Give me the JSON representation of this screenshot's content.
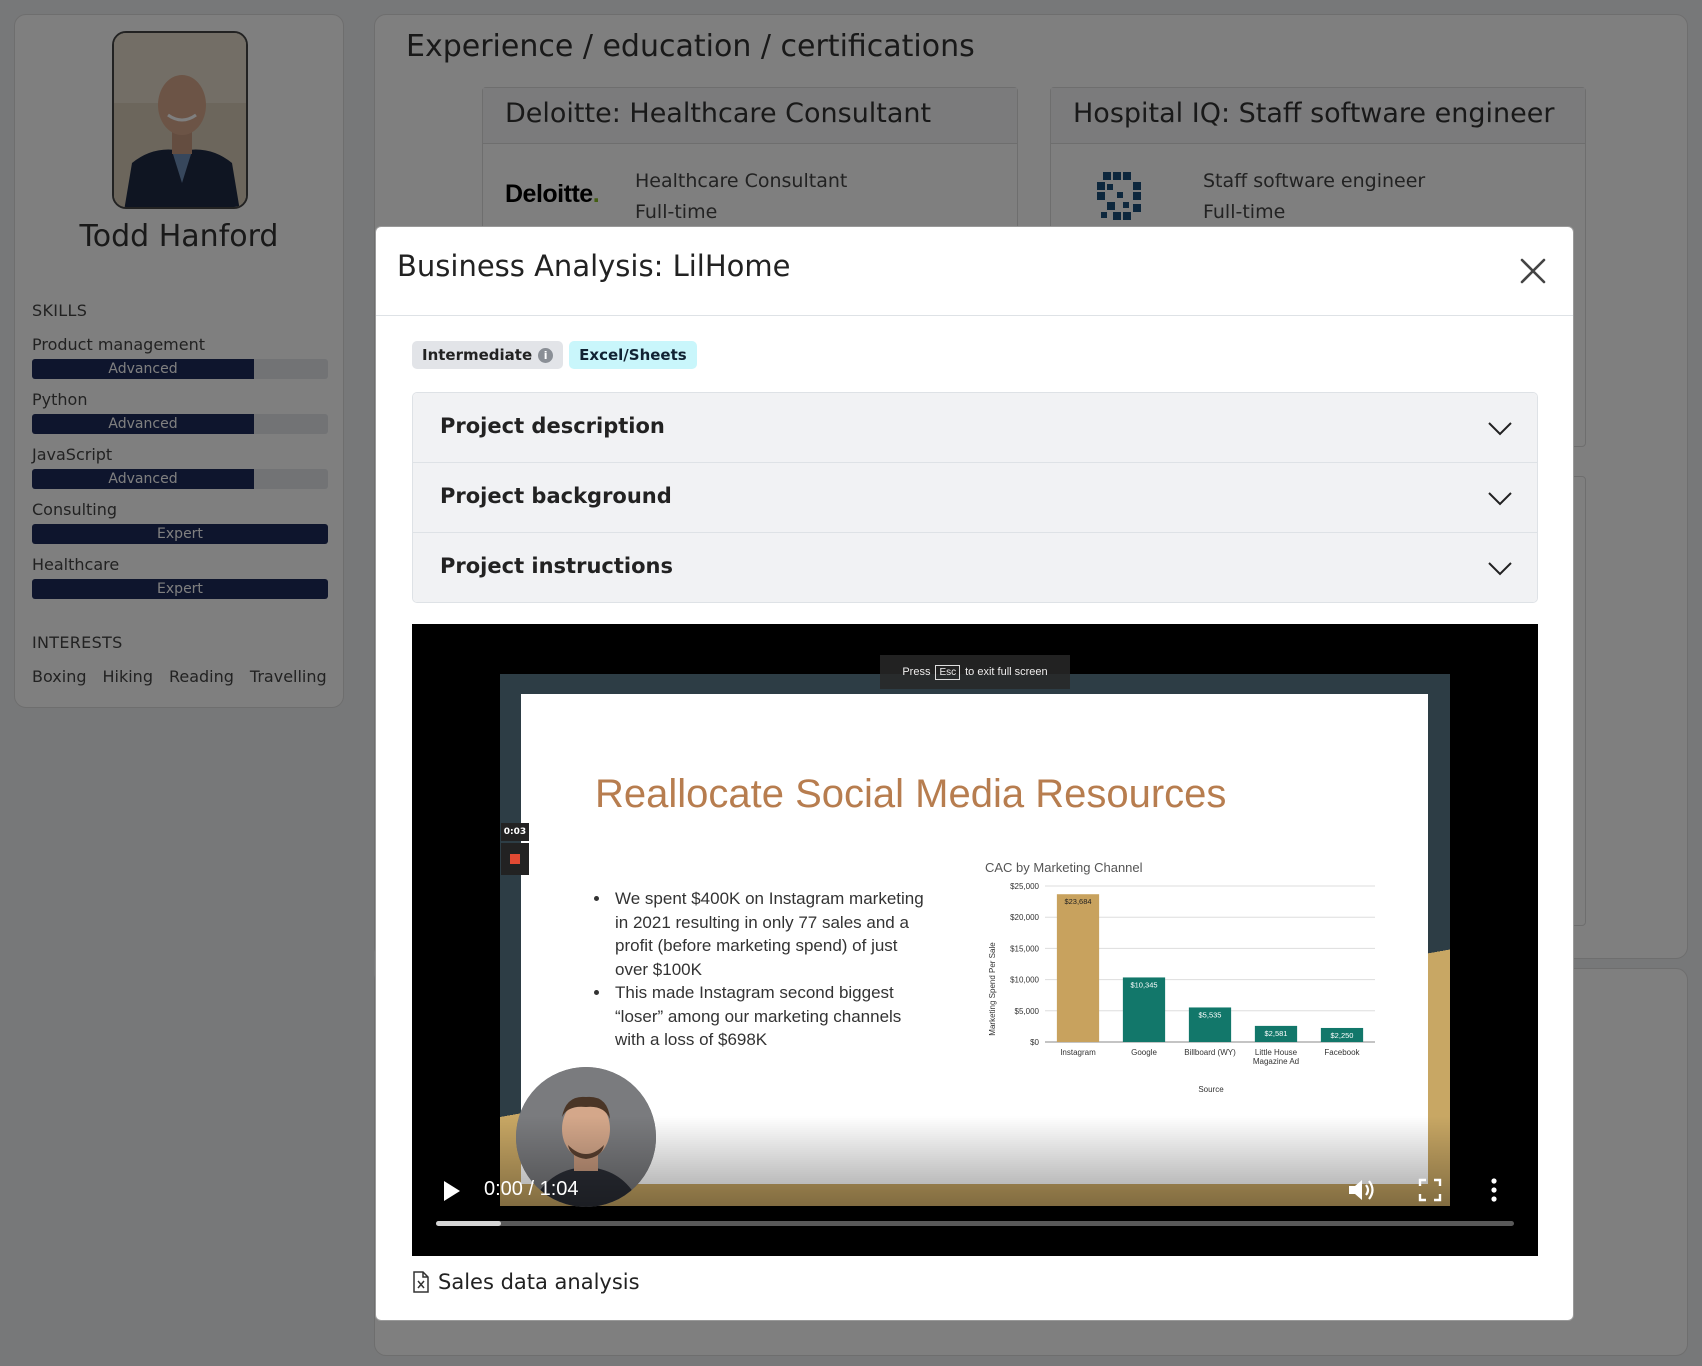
{
  "profile": {
    "name": "Todd Hanford",
    "skills_heading": "SKILLS",
    "skills": [
      {
        "name": "Product management",
        "level": "Advanced",
        "fill_fraction": 0.75
      },
      {
        "name": "Python",
        "level": "Advanced",
        "fill_fraction": 0.75
      },
      {
        "name": "JavaScript",
        "level": "Advanced",
        "fill_fraction": 0.75
      },
      {
        "name": "Consulting",
        "level": "Expert",
        "fill_fraction": 1.0
      },
      {
        "name": "Healthcare",
        "level": "Expert",
        "fill_fraction": 1.0
      }
    ],
    "interests_heading": "INTERESTS",
    "interests": [
      "Boxing",
      "Hiking",
      "Reading",
      "Travelling"
    ]
  },
  "experience": {
    "title": "Experience / education / certifications",
    "cards": [
      {
        "header": "Deloitte: Healthcare Consultant",
        "role": "Healthcare Consultant",
        "type": "Full-time",
        "logo_text": "Deloitte",
        "logo_dot": "."
      },
      {
        "header": "Hospital IQ: Staff software engineer",
        "role": "Staff software engineer",
        "type": "Full-time"
      }
    ]
  },
  "modal": {
    "title": "Business Analysis: LilHome",
    "badges": {
      "level": "Intermediate",
      "tool": "Excel/Sheets"
    },
    "accordion": [
      "Project description",
      "Project background",
      "Project instructions"
    ],
    "attachment": "Sales data analysis"
  },
  "video": {
    "esc_hint_pre": "Press",
    "esc_key": "Esc",
    "esc_hint_post": "to exit full screen",
    "record_time": "0:03",
    "time": "0:00 / 1:04",
    "buffered_fraction": 0.06,
    "slide": {
      "title": "Reallocate Social Media Resources",
      "bullets": [
        "We spent $400K on Instagram marketing in 2021 resulting in only 77 sales and a profit (before marketing spend) of just over $100K",
        "This made Instagram second biggest “loser” among our marketing channels with a loss of $698K"
      ]
    }
  },
  "colors": {
    "accent": "#1c2a5a",
    "bar_gold": "#c8a25e",
    "bar_teal": "#12776a",
    "slide_title": "#b77d4f"
  },
  "chart_data": {
    "type": "bar",
    "title": "CAC by Marketing Channel",
    "xlabel": "Source",
    "ylabel": "Marketing Spend Per Sale",
    "categories": [
      "Instagram",
      "Google",
      "Billboard (WY)",
      "Little House Magazine Ad",
      "Facebook"
    ],
    "category_lines": [
      [
        "Instagram"
      ],
      [
        "Google"
      ],
      [
        "Billboard (WY)"
      ],
      [
        "Little House",
        "Magazine Ad"
      ],
      [
        "Facebook"
      ]
    ],
    "values": [
      23684,
      10345,
      5535,
      2581,
      2250
    ],
    "value_labels": [
      "$23,684",
      "$10,345",
      "$5,535",
      "$2,581",
      "$2,250"
    ],
    "bar_colors": [
      "#c8a25e",
      "#12776a",
      "#12776a",
      "#12776a",
      "#12776a"
    ],
    "ylim": [
      0,
      25000
    ],
    "yticks": [
      0,
      5000,
      10000,
      15000,
      20000,
      25000
    ],
    "ytick_labels": [
      "$0",
      "$5,000",
      "$10,000",
      "$15,000",
      "$20,000",
      "$25,000"
    ],
    "grid": true
  }
}
